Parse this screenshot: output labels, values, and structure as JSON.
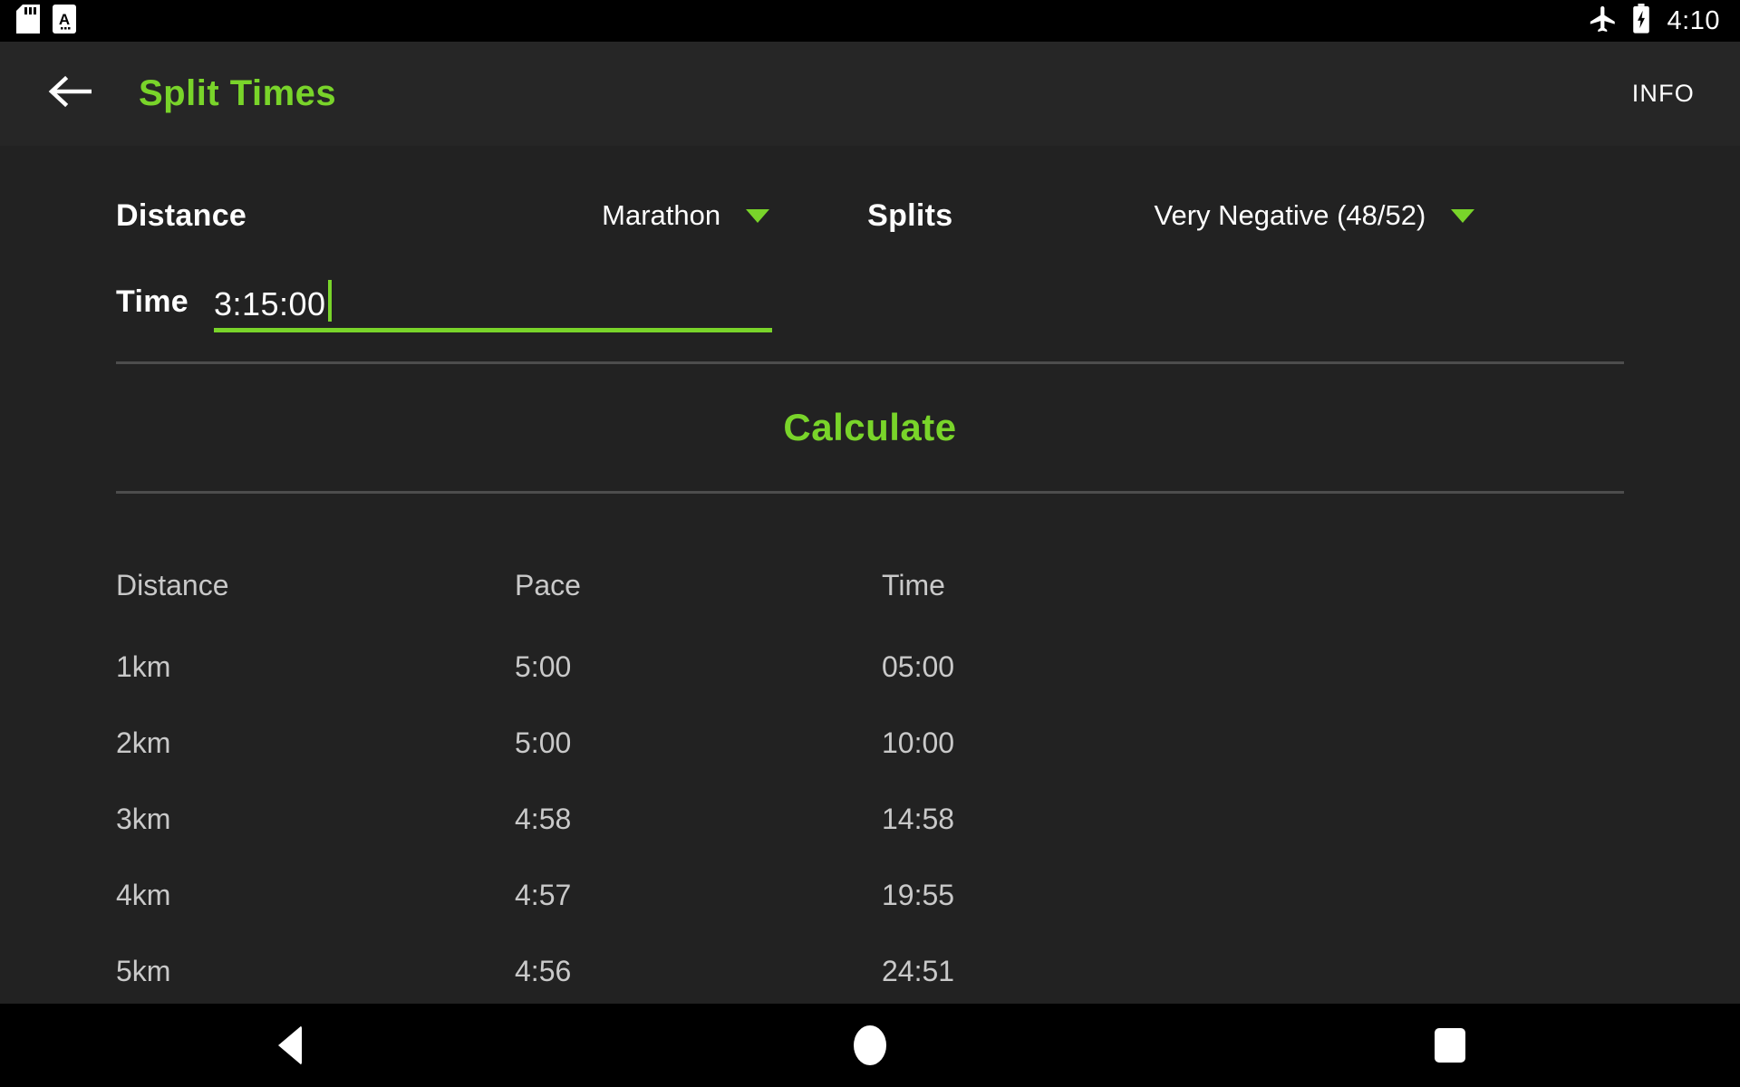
{
  "status_bar": {
    "icons": [
      "sd-card-icon",
      "text-file-icon"
    ],
    "airplane_icon": "airplane-mode-icon",
    "battery_icon": "battery-charging-icon",
    "clock": "4:10"
  },
  "app_bar": {
    "back_icon": "arrow-left-icon",
    "title": "Split Times",
    "info_label": "INFO",
    "title_color": "#79d42a"
  },
  "form": {
    "distance_label": "Distance",
    "distance_value": "Marathon",
    "splits_label": "Splits",
    "splits_value": "Very Negative (48/52)",
    "time_label": "Time",
    "time_value": "3:15:00",
    "caret_icon": "chevron-down-icon",
    "accent_color": "#79d42a"
  },
  "calculate": {
    "label": "Calculate"
  },
  "chart_data": {
    "type": "table",
    "title": "Split Times",
    "columns": [
      "Distance",
      "Pace",
      "Time"
    ],
    "rows": [
      [
        "1km",
        "5:00",
        "05:00"
      ],
      [
        "2km",
        "5:00",
        "10:00"
      ],
      [
        "3km",
        "4:58",
        "14:58"
      ],
      [
        "4km",
        "4:57",
        "19:55"
      ],
      [
        "5km",
        "4:56",
        "24:51"
      ]
    ]
  },
  "nav_bar": {
    "back_icon": "nav-back-triangle-icon",
    "home_icon": "nav-home-circle-icon",
    "recents_icon": "nav-recents-square-icon"
  }
}
